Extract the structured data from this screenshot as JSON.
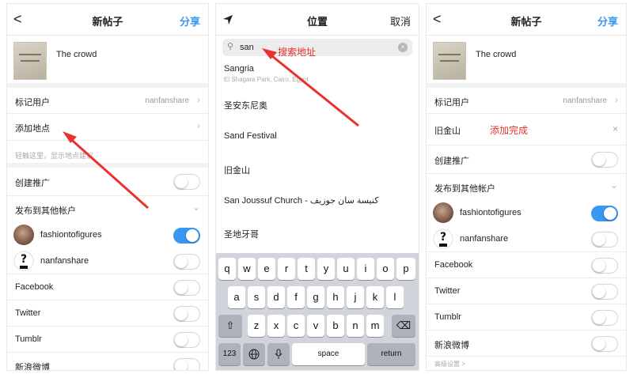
{
  "panel1": {
    "nav": {
      "back": "<",
      "title": "新帖子",
      "action": "分享"
    },
    "post": {
      "caption": "The crowd"
    },
    "tag_people": {
      "label": "标记用户",
      "value": "nanfanshare"
    },
    "add_location": {
      "label": "添加地点",
      "hint": "轻触这里，显示地点建议"
    },
    "promote": {
      "label": "创建推广"
    },
    "share_other": {
      "label": "发布到其他帐户"
    },
    "accounts": [
      {
        "name": "fashiontofigures",
        "on": true
      },
      {
        "name": "nanfanshare",
        "on": false
      }
    ],
    "networks": [
      "Facebook",
      "Twitter",
      "Tumblr",
      "新浪微博"
    ]
  },
  "panel2": {
    "nav": {
      "title": "位置",
      "cancel": "取消"
    },
    "search": {
      "value": "san"
    },
    "annotation": "搜索地址",
    "results": [
      {
        "name": "Sangria",
        "sub": "El Shagara Park, Cairo, Egypt"
      },
      {
        "name": "圣安东尼奥",
        "sub": ""
      },
      {
        "name": "Sand Festival",
        "sub": ""
      },
      {
        "name": "旧金山",
        "sub": ""
      },
      {
        "name": "San Joussuf Church - كنيسة سان جوزيف",
        "sub": ""
      },
      {
        "name": "圣地牙哥",
        "sub": ""
      }
    ],
    "keyboard": {
      "row1": [
        "q",
        "w",
        "e",
        "r",
        "t",
        "y",
        "u",
        "i",
        "o",
        "p"
      ],
      "row2": [
        "a",
        "s",
        "d",
        "f",
        "g",
        "h",
        "j",
        "k",
        "l"
      ],
      "row3": [
        "z",
        "x",
        "c",
        "v",
        "b",
        "n",
        "m"
      ],
      "num": "123",
      "space": "space",
      "return": "return"
    }
  },
  "panel3": {
    "nav": {
      "back": "<",
      "title": "新帖子",
      "action": "分享"
    },
    "post": {
      "caption": "The crowd"
    },
    "tag_people": {
      "label": "标记用户",
      "value": "nanfanshare"
    },
    "location": {
      "label": "旧金山",
      "annotation": "添加完成",
      "clear": "×"
    },
    "promote": {
      "label": "创建推广"
    },
    "share_other": {
      "label": "发布到其他帐户"
    },
    "accounts": [
      {
        "name": "fashiontofigures",
        "on": true
      },
      {
        "name": "nanfanshare",
        "on": false
      }
    ],
    "networks": [
      "Facebook",
      "Twitter",
      "Tumblr",
      "新浪微博"
    ],
    "advanced": "高级设置 >"
  },
  "colors": {
    "accent": "#3897f0",
    "annotation": "#e8322b"
  },
  "icons": [
    "back-icon",
    "chevron-right-icon",
    "location-arrow-icon",
    "search-icon",
    "clear-icon",
    "shift-icon",
    "backspace-icon",
    "globe-icon",
    "mic-icon"
  ]
}
